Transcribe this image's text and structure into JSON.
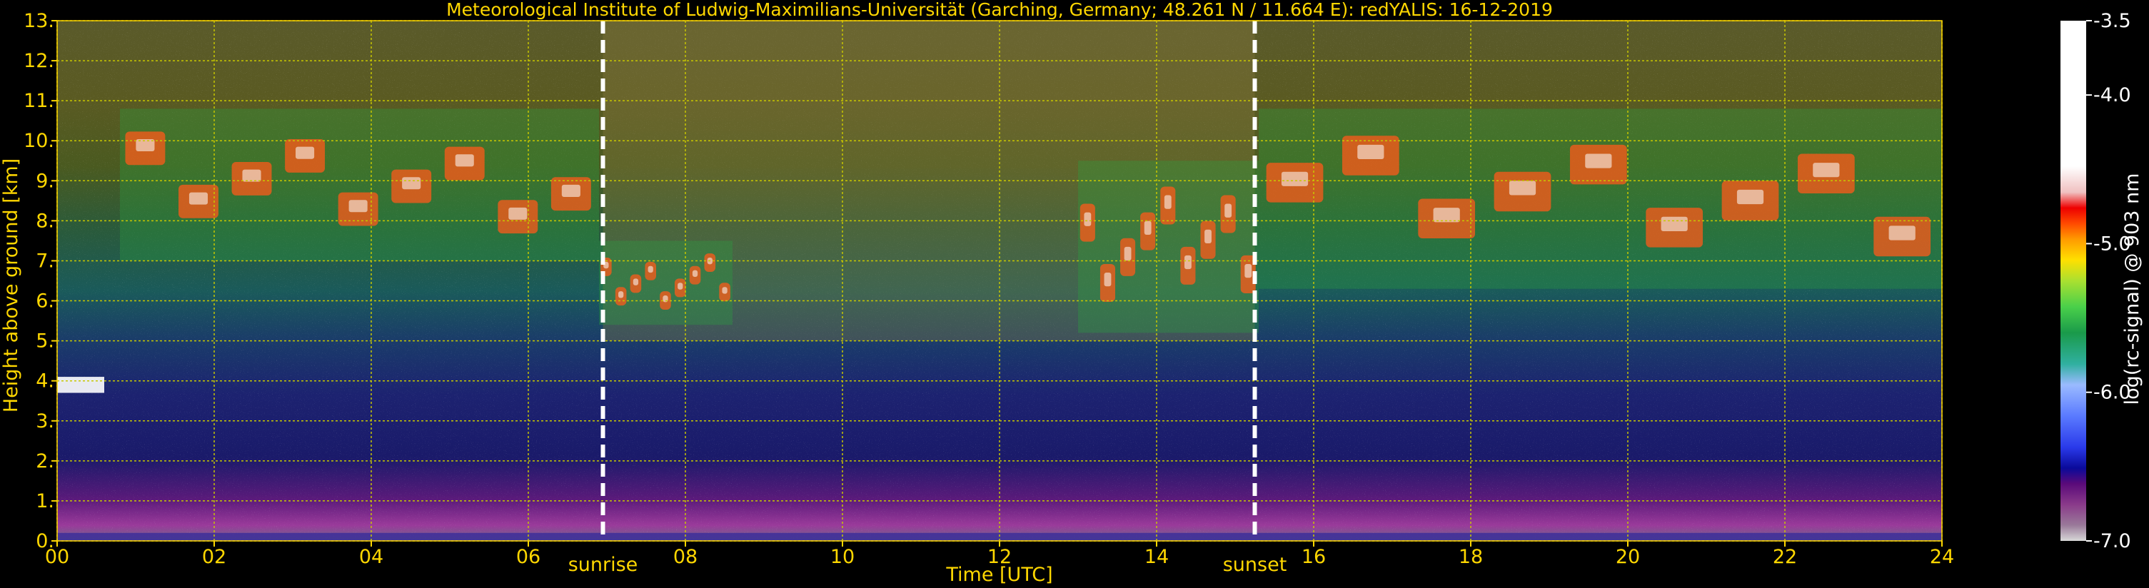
{
  "chart_data": {
    "type": "heatmap",
    "title": "Meteorological Institute of Ludwig-Maximilians-Universität (Garching, Germany; 48.261 N / 11.664 E):    redYALIS: 16-12-2019",
    "xlabel": "Time [UTC]",
    "ylabel": "Height above ground [km]",
    "xlim": [
      0,
      24
    ],
    "ylim": [
      0,
      13
    ],
    "x_ticks": [
      "00",
      "02",
      "04",
      "06",
      "08",
      "10",
      "12",
      "14",
      "16",
      "18",
      "20",
      "22",
      "24"
    ],
    "y_ticks": [
      "0.",
      "1.",
      "2.",
      "3.",
      "4.",
      "5.",
      "6.",
      "7.",
      "8.",
      "9.",
      "10.",
      "11.",
      "12.",
      "13."
    ],
    "grid": true,
    "markers": [
      {
        "label": "sunrise",
        "time": 6.95
      },
      {
        "label": "sunset",
        "time": 15.25
      }
    ],
    "colorbar": {
      "label": "log(rc-signal) @ 903 nm",
      "range": [
        -7.0,
        -3.5
      ],
      "ticks": [
        "-3.5",
        "-4.0",
        "-5.0",
        "-6.0",
        "-7.0"
      ],
      "tick_values": [
        -3.5,
        -4.0,
        -5.0,
        -6.0,
        -7.0
      ]
    },
    "features": [
      {
        "kind": "cirrus",
        "t_start": 0.8,
        "t_end": 6.9,
        "base_km": 7.0,
        "top_km": 10.8
      },
      {
        "kind": "cirrus",
        "t_start": 6.9,
        "t_end": 8.6,
        "base_km": 5.4,
        "top_km": 7.5
      },
      {
        "kind": "cirrus",
        "t_start": 13.0,
        "t_end": 15.3,
        "base_km": 5.2,
        "top_km": 9.5
      },
      {
        "kind": "cirrus",
        "t_start": 15.3,
        "t_end": 24.0,
        "base_km": 6.3,
        "top_km": 10.8
      },
      {
        "kind": "low-layer",
        "t_start": 0.0,
        "t_end": 0.6,
        "base_km": 3.7,
        "top_km": 4.1
      }
    ],
    "colors": {
      "text": "#ffd700",
      "grid": "#c8c800",
      "marker": "#ffffff",
      "background": "#000000"
    }
  }
}
